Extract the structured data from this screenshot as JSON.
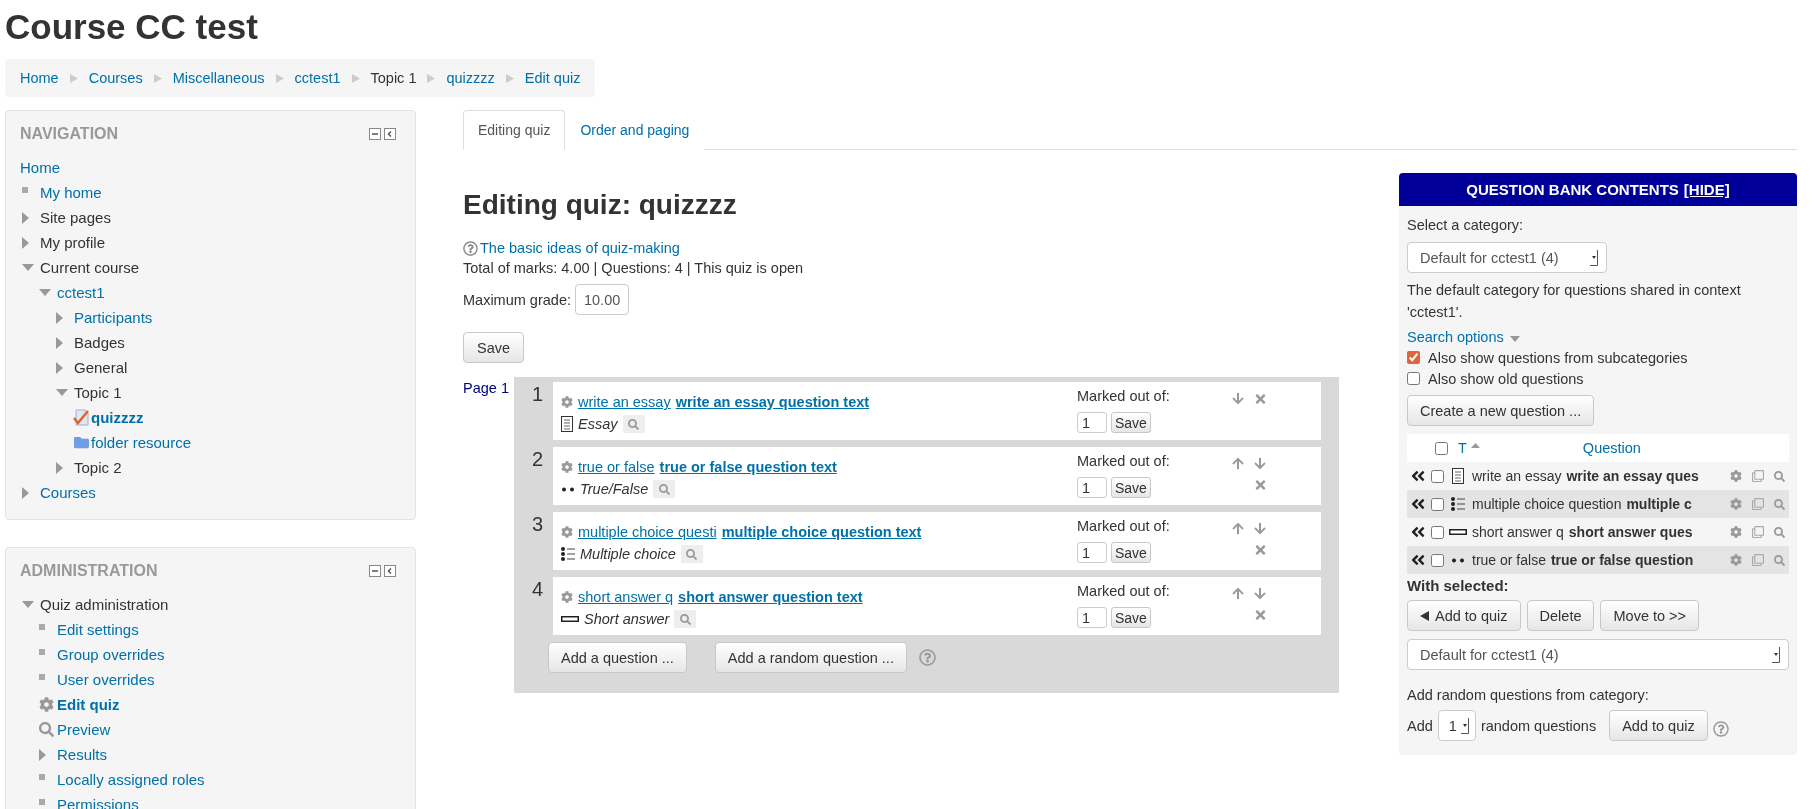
{
  "page_title": "Course CC test",
  "breadcrumbs": [
    {
      "label": "Home",
      "link": true
    },
    {
      "label": "Courses",
      "link": true
    },
    {
      "label": "Miscellaneous",
      "link": true
    },
    {
      "label": "cctest1",
      "link": true
    },
    {
      "label": "Topic 1",
      "link": false
    },
    {
      "label": "quizzzz",
      "link": true
    },
    {
      "label": "Edit quiz",
      "link": true
    }
  ],
  "blocks": [
    {
      "title": "NAVIGATION",
      "items": [
        {
          "label": "Home",
          "link": true,
          "current": false
        },
        {
          "label": "My home",
          "link": true,
          "kind": "bullet",
          "current": false
        },
        {
          "label": "Site pages",
          "link": false,
          "kind": "collapsed",
          "current": false
        },
        {
          "label": "My profile",
          "link": false,
          "kind": "collapsed",
          "current": false
        },
        {
          "label": "Current course",
          "link": false,
          "kind": "expanded",
          "current": false,
          "children": [
            {
              "label": "cctest1",
              "link": true,
              "kind": "expanded",
              "current": false,
              "children": [
                {
                  "label": "Participants",
                  "link": true,
                  "kind": "collapsed",
                  "current": false
                },
                {
                  "label": "Badges",
                  "link": false,
                  "kind": "collapsed",
                  "current": false
                },
                {
                  "label": "General",
                  "link": false,
                  "kind": "collapsed",
                  "current": false
                },
                {
                  "label": "Topic 1",
                  "link": false,
                  "kind": "expanded",
                  "current": false,
                  "children": [
                    {
                      "label": "quizzzz",
                      "link": true,
                      "kind": "quiz",
                      "current": true
                    },
                    {
                      "label": "folder resource",
                      "link": true,
                      "kind": "folder",
                      "current": false
                    }
                  ]
                },
                {
                  "label": "Topic 2",
                  "link": false,
                  "kind": "collapsed",
                  "current": false
                }
              ]
            }
          ]
        },
        {
          "label": "Courses",
          "link": true,
          "kind": "collapsed",
          "current": false
        }
      ]
    },
    {
      "title": "ADMINISTRATION",
      "items": [
        {
          "label": "Quiz administration",
          "link": false,
          "kind": "expanded",
          "current": false,
          "children": [
            {
              "label": "Edit settings",
              "link": true,
              "kind": "bullet",
              "current": false
            },
            {
              "label": "Group overrides",
              "link": true,
              "kind": "bullet",
              "current": false
            },
            {
              "label": "User overrides",
              "link": true,
              "kind": "bullet",
              "current": false
            },
            {
              "label": "Edit quiz",
              "link": true,
              "kind": "gear",
              "current": true
            },
            {
              "label": "Preview",
              "link": true,
              "kind": "search",
              "current": false
            },
            {
              "label": "Results",
              "link": true,
              "kind": "collapsed",
              "current": false
            },
            {
              "label": "Locally assigned roles",
              "link": true,
              "kind": "bullet",
              "current": false
            },
            {
              "label": "Permissions",
              "link": true,
              "kind": "bullet",
              "current": false
            }
          ]
        }
      ]
    }
  ],
  "tabs": [
    {
      "label": "Editing quiz",
      "selected": true
    },
    {
      "label": "Order and paging",
      "selected": false
    }
  ],
  "quiz": {
    "heading": "Editing quiz: quizzzz",
    "help_link": "The basic ideas of quiz-making",
    "summary": "Total of marks: 4.00 | Questions: 4 | This quiz is open",
    "max_grade_label": "Maximum grade:",
    "max_grade": "10.00",
    "save": "Save",
    "page_label": "Page 1",
    "questions": [
      {
        "number": "1",
        "name": "write an essay",
        "text": "write an essay question text",
        "kind": "essay",
        "type_label": "Essay",
        "marked_label": "Marked out of:",
        "mark": "1",
        "save": "Save",
        "move_up": false,
        "move_down": true
      },
      {
        "number": "2",
        "name": "true or false",
        "text": "true or false question text",
        "kind": "truefalse",
        "type_label": "True/False",
        "marked_label": "Marked out of:",
        "mark": "1",
        "save": "Save",
        "move_up": true,
        "move_down": true
      },
      {
        "number": "3",
        "name": "multiple choice questi",
        "text": "multiple choice question text",
        "kind": "multichoice",
        "type_label": "Multiple choice",
        "marked_label": "Marked out of:",
        "mark": "1",
        "save": "Save",
        "move_up": true,
        "move_down": true
      },
      {
        "number": "4",
        "name": "short answer q",
        "text": "short answer question text",
        "kind": "shortanswer",
        "type_label": "Short answer",
        "marked_label": "Marked out of:",
        "mark": "1",
        "save": "Save",
        "move_up": true,
        "move_down": true
      }
    ],
    "add_question": "Add a question ...",
    "add_random": "Add a random question ..."
  },
  "question_bank": {
    "title": "QUESTION BANK CONTENTS",
    "hide_link": "[HIDE]",
    "category_label": "Select a category:",
    "category": "Default for cctest1 (4)",
    "category_info": "The default category for questions shared in context 'cctest1'.",
    "search_options": "Search options",
    "options": [
      {
        "label": "Also show questions from subcategories",
        "checked": true
      },
      {
        "label": "Also show old questions",
        "checked": false
      }
    ],
    "create_button": "Create a new question ...",
    "select_all": false,
    "type_column": "T",
    "question_column": "Question",
    "rows": [
      {
        "kind": "essay",
        "name": "write an essay",
        "text": "write an essay ques",
        "checked": false
      },
      {
        "kind": "multichoice",
        "name": "multiple choice question",
        "text": "multiple c",
        "checked": false
      },
      {
        "kind": "shortanswer",
        "name": "short answer q",
        "text": "short answer ques",
        "checked": false
      },
      {
        "kind": "truefalse",
        "name": "true or false",
        "text": "true or false question",
        "checked": false
      }
    ],
    "with_selected": "With selected:",
    "actions": [
      {
        "label": "Add to quiz",
        "kind": "add"
      },
      {
        "label": "Delete",
        "kind": "plain"
      },
      {
        "label": "Move to >>",
        "kind": "plain"
      }
    ],
    "move_target": "Default for cctest1 (4)",
    "random_label": "Add random questions from category:",
    "random_add": "Add",
    "random_count": "1",
    "random_suffix": "random questions",
    "random_button": "Add to quiz"
  }
}
